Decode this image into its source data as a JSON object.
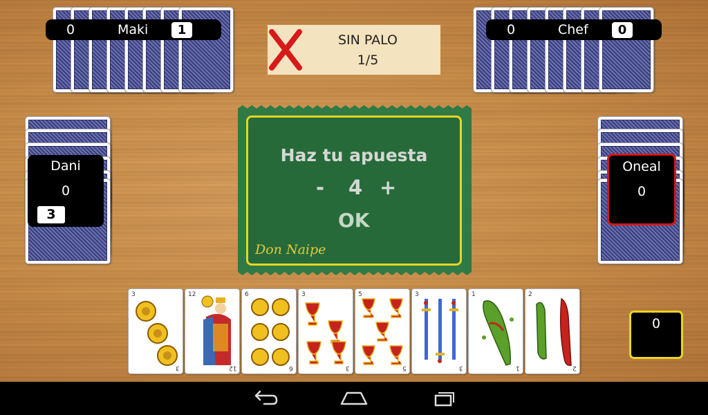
{
  "players": {
    "top_left": {
      "name": "Maki",
      "score": "0",
      "bid": "1"
    },
    "top_right": {
      "name": "Chef",
      "score": "0",
      "bid": "0"
    },
    "left": {
      "name": "Dani",
      "score": "0",
      "bid": "3"
    },
    "right": {
      "name": "Oneal",
      "score": "0"
    }
  },
  "trump": {
    "label": "SIN PALO",
    "round": "1/5"
  },
  "bet_dialog": {
    "title": "Haz tu apuesta",
    "minus": "-",
    "value": "4",
    "plus": "+",
    "ok": "OK",
    "brand": "Don Naipe"
  },
  "hand": [
    {
      "rank": "3",
      "suit": "oros",
      "suit_name": "coins"
    },
    {
      "rank": "12",
      "suit": "oros",
      "suit_name": "coins-king"
    },
    {
      "rank": "6",
      "suit": "oros",
      "suit_name": "coins"
    },
    {
      "rank": "3",
      "suit": "copas",
      "suit_name": "cups"
    },
    {
      "rank": "5",
      "suit": "copas",
      "suit_name": "cups"
    },
    {
      "rank": "3",
      "suit": "espadas",
      "suit_name": "swords"
    },
    {
      "rank": "1",
      "suit": "bastos",
      "suit_name": "clubs"
    },
    {
      "rank": "2",
      "suit": "bastos",
      "suit_name": "clubs"
    }
  ],
  "tricks": {
    "count": "0"
  },
  "colors": {
    "felt": "#2f7a45",
    "felt_border": "#e8d622",
    "active_player": "#d41818",
    "card_back": "#4a4f90"
  },
  "navbar": {
    "back_icon": "back-icon",
    "home_icon": "home-icon",
    "recents_icon": "recents-icon"
  }
}
